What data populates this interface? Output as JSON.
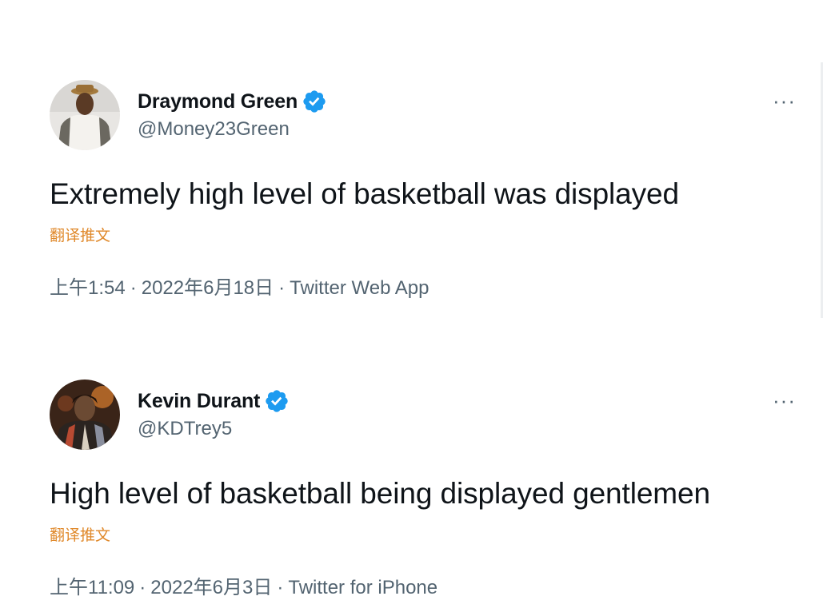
{
  "tweets": [
    {
      "author": {
        "name": "Draymond Green",
        "handle": "@Money23Green"
      },
      "more_label": "···",
      "text": "Extremely high level of basketball was displayed",
      "translate_label": "翻译推文",
      "time": "上午1:54",
      "date": "2022年6月18日",
      "source": "Twitter Web App",
      "separator": "·"
    },
    {
      "author": {
        "name": "Kevin Durant",
        "handle": "@KDTrey5"
      },
      "more_label": "···",
      "text": "High level of basketball being displayed gentlemen",
      "translate_label": "翻译推文",
      "time": "上午11:09",
      "date": "2022年6月3日",
      "source": "Twitter for iPhone",
      "separator": "·"
    }
  ],
  "icons": {
    "verified": "verified-badge-icon",
    "more": "more-horizontal-icon"
  },
  "colors": {
    "verified_blue": "#1d9bf0",
    "secondary_text": "#536471",
    "translate_link": "#e0892b",
    "primary_text": "#0f1419"
  }
}
